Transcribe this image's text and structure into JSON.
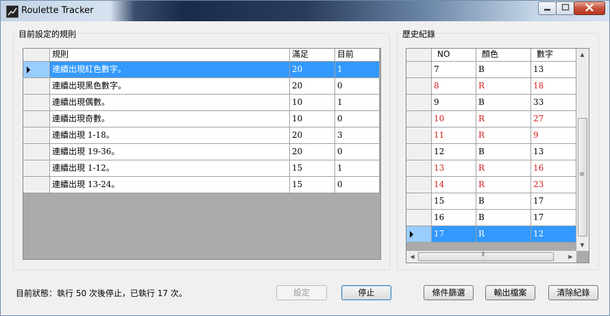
{
  "window": {
    "title": "Roulette Tracker"
  },
  "rules_panel": {
    "label": "目前設定的規則",
    "columns": [
      "規則",
      "滿足",
      "目前"
    ],
    "rows": [
      {
        "rule": "連續出現紅色數字。",
        "meet": "20",
        "current": "1",
        "selected": true
      },
      {
        "rule": "連續出現黑色數字。",
        "meet": "20",
        "current": "0"
      },
      {
        "rule": "連續出現偶數。",
        "meet": "10",
        "current": "1"
      },
      {
        "rule": "連續出現奇數。",
        "meet": "10",
        "current": "0"
      },
      {
        "rule": "連續出現 1-18。",
        "meet": "20",
        "current": "3"
      },
      {
        "rule": "連續出現 19-36。",
        "meet": "20",
        "current": "0"
      },
      {
        "rule": "連續出現 1-12。",
        "meet": "15",
        "current": "1"
      },
      {
        "rule": "連續出現 13-24。",
        "meet": "15",
        "current": "0"
      }
    ]
  },
  "history_panel": {
    "label": "歷史紀錄",
    "columns": [
      "NO",
      "顏色",
      "數字"
    ],
    "rows": [
      {
        "no": "7",
        "color": "B",
        "number": "13"
      },
      {
        "no": "8",
        "color": "R",
        "number": "18"
      },
      {
        "no": "9",
        "color": "B",
        "number": "33"
      },
      {
        "no": "10",
        "color": "R",
        "number": "27"
      },
      {
        "no": "11",
        "color": "R",
        "number": "9"
      },
      {
        "no": "12",
        "color": "B",
        "number": "13"
      },
      {
        "no": "13",
        "color": "R",
        "number": "16"
      },
      {
        "no": "14",
        "color": "R",
        "number": "23"
      },
      {
        "no": "15",
        "color": "B",
        "number": "17"
      },
      {
        "no": "16",
        "color": "B",
        "number": "17"
      },
      {
        "no": "17",
        "color": "R",
        "number": "12",
        "selected": true
      }
    ],
    "scroll_grip": "≡",
    "hscroll_grip": "⦀"
  },
  "status": {
    "text": "目前狀態：執行 50 次後停止，已執行 17 次。"
  },
  "buttons": {
    "settings": "設定",
    "stop": "停止",
    "filter": "條件篩選",
    "export": "輸出檔案",
    "clear": "清除紀錄"
  },
  "colors": {
    "selection": "#3399ff",
    "red_text": "#d61a1a",
    "grid_bg": "#ababab"
  }
}
